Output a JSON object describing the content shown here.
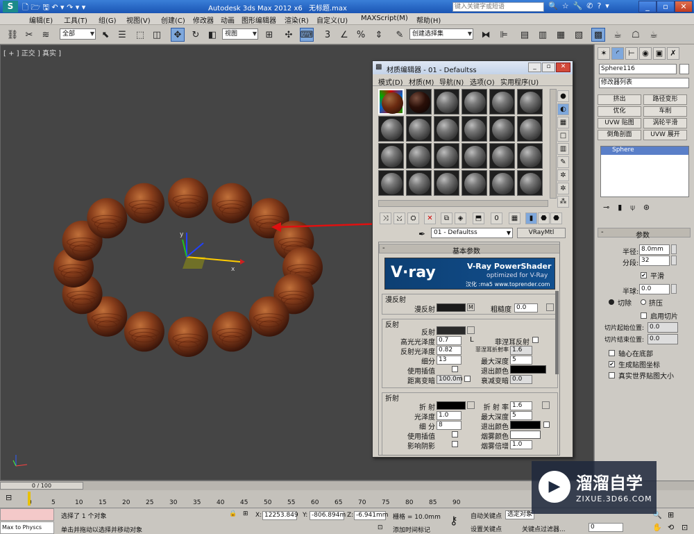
{
  "window": {
    "app_title": "Autodesk 3ds Max  2012 x6",
    "doc_title": "无标题.max",
    "search_placeholder": "键入关键字或短语"
  },
  "menubar": [
    "编辑(E)",
    "工具(T)",
    "组(G)",
    "视图(V)",
    "创建(C)",
    "修改器",
    "动画",
    "图形编辑器",
    "渲染(R)",
    "自定义(U)",
    "MAXScript(M)",
    "帮助(H)"
  ],
  "toolbar": {
    "filter_value": "全部",
    "refcoord_value": "视图",
    "selset_value": "创建选择集"
  },
  "viewport": {
    "label": "[ + ] 正交 ] 真实 ]",
    "axis_y": "y",
    "axis_x": "x"
  },
  "material_editor": {
    "title": "材质编辑器 - 01 - Defaultss",
    "menu": [
      "模式(D)",
      "材质(M)",
      "导航(N)",
      "选项(O)",
      "实用程序(U)"
    ],
    "material_name": "01 - Defaultss",
    "material_type": "VRayMtl",
    "rollout_title": "基本参数",
    "vray_logo": "V·ray",
    "vray_banner_title": "V-Ray PowerShader",
    "vray_banner_sub": "optimized for V-Ray",
    "vray_banner_url": "汉化 :ma5 www.toprender.com",
    "diffuse_group": "漫反射",
    "diffuse_label": "漫反射",
    "diffuse_map_btn": "M",
    "roughness_label": "粗糙度",
    "roughness_value": "0.0",
    "reflect_group": "反射",
    "reflect_label": "反射",
    "hilight_gloss_label": "高光光泽度",
    "hilight_gloss_value": "0.7",
    "lock_label": "L",
    "fresnel_label": "菲涅耳反射",
    "refl_gloss_label": "反射光泽度",
    "refl_gloss_value": "0.82",
    "fresnel_ior_label": "菲涅耳折射率",
    "fresnel_ior_value": "1.6",
    "refl_subdivs_label": "细分",
    "refl_subdivs_value": "13",
    "max_depth_label": "最大深度",
    "max_depth_value": "5",
    "use_interp_label": "使用插值",
    "exit_color_label": "退出颜色",
    "dist_dim_label": "距离变暗",
    "dist_dim_value": "100.0m",
    "dim_falloff_label": "衰减变暗",
    "dim_falloff_value": "0.0",
    "refract_group": "折射",
    "refract_label": "折 射",
    "ior_label": "折 射 率",
    "ior_value": "1.6",
    "gloss_label": "光泽度",
    "gloss_value": "1.0",
    "refr_max_depth_label": "最大深度",
    "refr_max_depth_value": "5",
    "refr_subdivs_label": "细 分",
    "refr_subdivs_value": "8",
    "refr_exit_label": "退出颜色",
    "refr_interp_label": "使用插值",
    "fog_color_label": "烟雾颜色",
    "affect_shadows_label": "影响阴影",
    "fog_mult_label": "烟雾倍增",
    "fog_mult_value": "1.0",
    "colors": {
      "diffuse": "#1a1a1a",
      "reflect": "#2a2a2a",
      "refract": "#000000",
      "exit": "#000000",
      "fog": "#ffffff"
    }
  },
  "command_panel": {
    "object_name": "Sphere116",
    "modifier_list": "修改器列表",
    "buttons": [
      "挤出",
      "路径变形",
      "优化",
      "车削",
      "UVW 贴图",
      "涡轮平滑",
      "倒角剖面",
      "UVW 展开"
    ],
    "stack_item": "Sphere",
    "params_title": "参数",
    "radius_label": "半径:",
    "radius_value": "8.0mm",
    "segments_label": "分段:",
    "segments_value": "32",
    "smooth_label": "平滑",
    "hemisphere_label": "半球:",
    "hemisphere_value": "0.0",
    "chop_label": "切除",
    "squash_label": "挤压",
    "slice_on_label": "启用切片",
    "slice_from_label": "切片起始位置:",
    "slice_from_value": "0.0",
    "slice_to_label": "切片结束位置:",
    "slice_to_value": "0.0",
    "base_pivot_label": "轴心在底部",
    "gen_map_label": "生成贴图坐标",
    "real_world_label": "真实世界贴图大小"
  },
  "timeline": {
    "frame": "0 / 100",
    "ticks": [
      "0",
      "5",
      "10",
      "15",
      "20",
      "25",
      "30",
      "35",
      "40",
      "45",
      "50",
      "55",
      "60",
      "65",
      "70",
      "75",
      "80",
      "85",
      "90"
    ]
  },
  "status": {
    "maxscript": "Max to Physcs",
    "selected": "选择了 1 个对象",
    "prompt": "单击并拖动以选择并移动对象",
    "x_label": "X:",
    "x_value": "12253.849",
    "y_label": "Y:",
    "y_value": "-806.894m",
    "z_label": "Z:",
    "z_value": "-6.941mm",
    "grid": "栅格 = 10.0mm",
    "add_time_tag": "添加时间标记",
    "auto_key": "自动关键点",
    "set_key": "设置关键点",
    "selected_dropdown": "选定对象",
    "key_filters": "关键点过滤器...",
    "frame_field": "0"
  },
  "watermark": {
    "name": "溜溜自学",
    "url": "ZIXUE.3D66.COM"
  }
}
